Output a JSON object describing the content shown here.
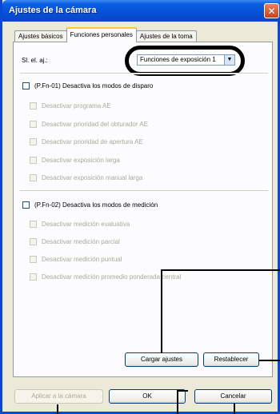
{
  "window": {
    "title": "Ajustes de la cámara",
    "close_glyph": "✕"
  },
  "tabs": [
    {
      "label": "Ajustes básicos"
    },
    {
      "label": "Funciones personales"
    },
    {
      "label": "Ajustes de la toma"
    }
  ],
  "selector": {
    "label": "Sl. el. aj.:",
    "value": "Funciones de exposición 1",
    "arrow": "▼"
  },
  "group1": {
    "title": "(P.Fn-01) Desactiva los modos de disparo",
    "items": [
      "Desactivar programa AE",
      "Desactivar prioridad del obturador AE",
      "Desactivar prioridad de apertura AE",
      "Desactivar exposición larga",
      "Desactivar exposición manual larga"
    ]
  },
  "group2": {
    "title": "(P.Fn-02) Desactiva los modos de medición",
    "items": [
      "Desactivar medición evaluativa",
      "Desactivar medición parcial",
      "Desactivar medición puntual",
      "Desactivar medición promedio ponderada central"
    ]
  },
  "panel_buttons": {
    "load": "Cargar ajustes",
    "reset": "Restablecer"
  },
  "footer": {
    "apply": "Aplicar a la cámara",
    "ok": "OK",
    "cancel": "Cancelar"
  }
}
